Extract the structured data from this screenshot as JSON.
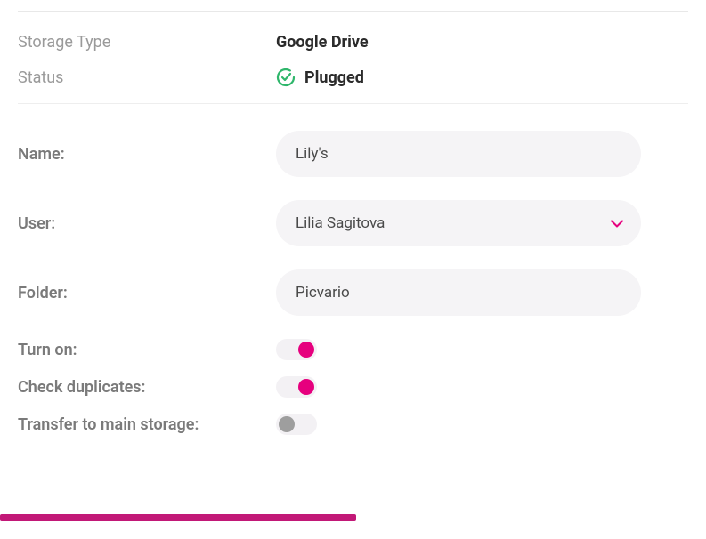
{
  "info": {
    "storage_type_label": "Storage Type",
    "storage_type_value": "Google Drive",
    "status_label": "Status",
    "status_value": "Plugged"
  },
  "form": {
    "name_label": "Name:",
    "name_value": "Lily's",
    "user_label": "User:",
    "user_value": "Lilia Sagitova",
    "folder_label": "Folder:",
    "folder_value": "Picvario",
    "turn_on_label": "Turn on:",
    "turn_on": true,
    "check_duplicates_label": "Check duplicates:",
    "check_duplicates": true,
    "transfer_label": "Transfer to main storage:",
    "transfer": false
  },
  "colors": {
    "accent": "#e6007e",
    "status_ok": "#2fb66b"
  }
}
